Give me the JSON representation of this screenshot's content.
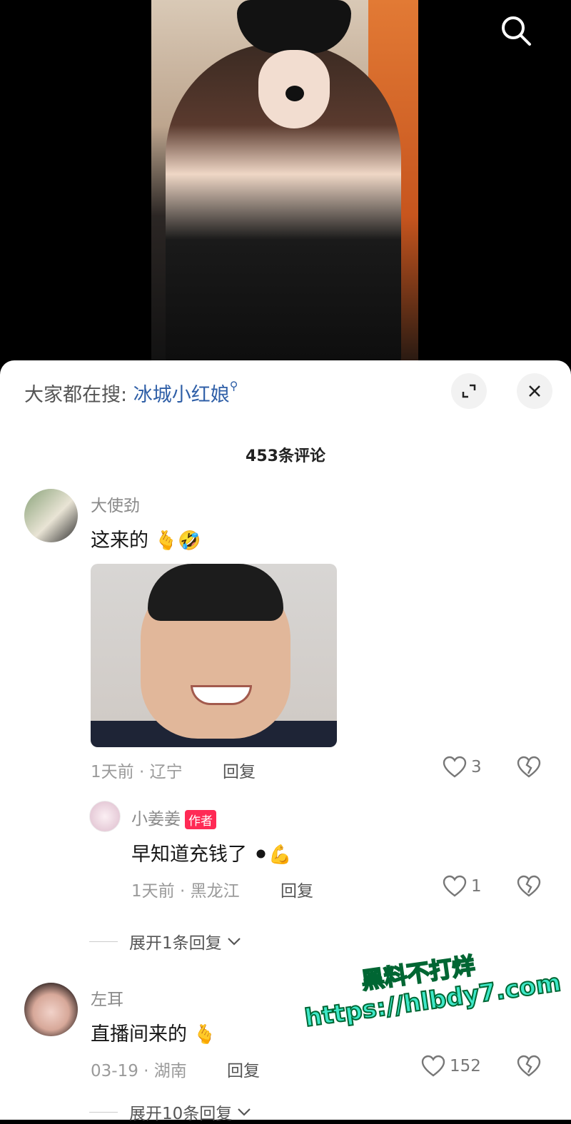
{
  "search_bar": {
    "prefix": "大家都在搜:",
    "keyword": "冰城小红娘"
  },
  "comments_count": "453条评论",
  "comments": [
    {
      "user": "大使劲",
      "text": "这来的",
      "emojis": [
        "🫰",
        "🤣"
      ],
      "time": "1天前",
      "location": "辽宁",
      "reply_label": "回复",
      "likes": "3",
      "replies": [
        {
          "user": "小姜姜",
          "badge": "作者",
          "text": "早知道充钱了",
          "emojis": [
            "⚫",
            "💪"
          ],
          "time": "1天前",
          "location": "黑龙江",
          "reply_label": "回复",
          "likes": "1"
        }
      ],
      "expand": "展开1条回复"
    },
    {
      "user": "左耳",
      "text": "直播间来的",
      "emojis": [
        "🫰"
      ],
      "time": "03-19",
      "location": "湖南",
      "reply_label": "回复",
      "likes": "152",
      "expand": "展开10条回复"
    }
  ],
  "watermark": {
    "line1": "黑料不打烊",
    "line2": "https://hlbdy7.com"
  },
  "colors": {
    "keyword": "#2f5fa7",
    "badge": "#ff2a55",
    "watermark": "#3de8c8"
  }
}
